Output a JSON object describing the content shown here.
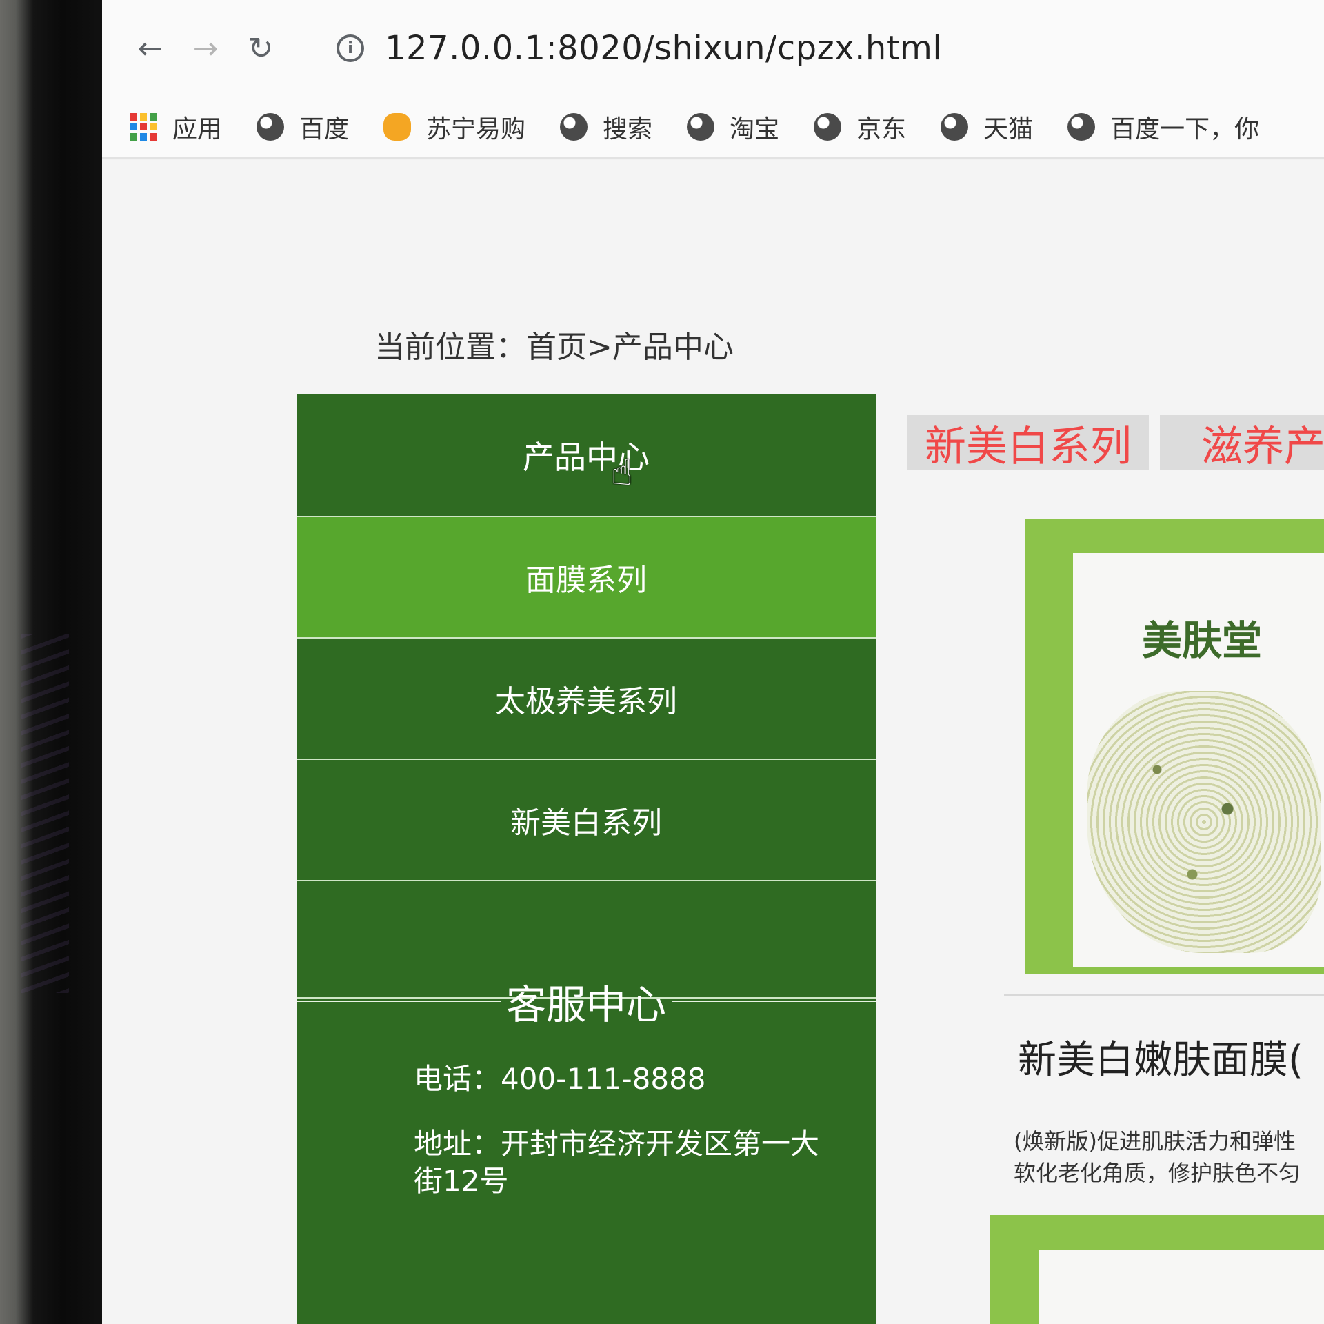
{
  "browser": {
    "url": "127.0.0.1:8020/shixun/cpzx.html",
    "bookmarks": [
      "应用",
      "百度",
      "苏宁易购",
      "搜索",
      "淘宝",
      "京东",
      "天猫",
      "百度一下，你"
    ]
  },
  "page": {
    "breadcrumb": "当前位置：首页>产品中心",
    "sidebar": {
      "title": "产品中心",
      "items": [
        "面膜系列",
        "太极养美系列",
        "新美白系列"
      ],
      "active_index": 0
    },
    "service": {
      "title": "客服中心",
      "phone": "电话：400-111-8888",
      "address": "地址：开封市经济开发区第一大街12号"
    },
    "tabs": [
      "新美白系列",
      "滋养产"
    ],
    "product": {
      "brand": "美肤堂",
      "name": "新美白嫩肤面膜(",
      "desc": "(焕新版)促进肌肤活力和弹性软化老化角质，修护肤色不匀"
    }
  },
  "colors": {
    "sidebar": "#2f6b22",
    "sidebar_active": "#57a72d",
    "tab_text": "#f04848",
    "card_border": "#8cc34a"
  }
}
